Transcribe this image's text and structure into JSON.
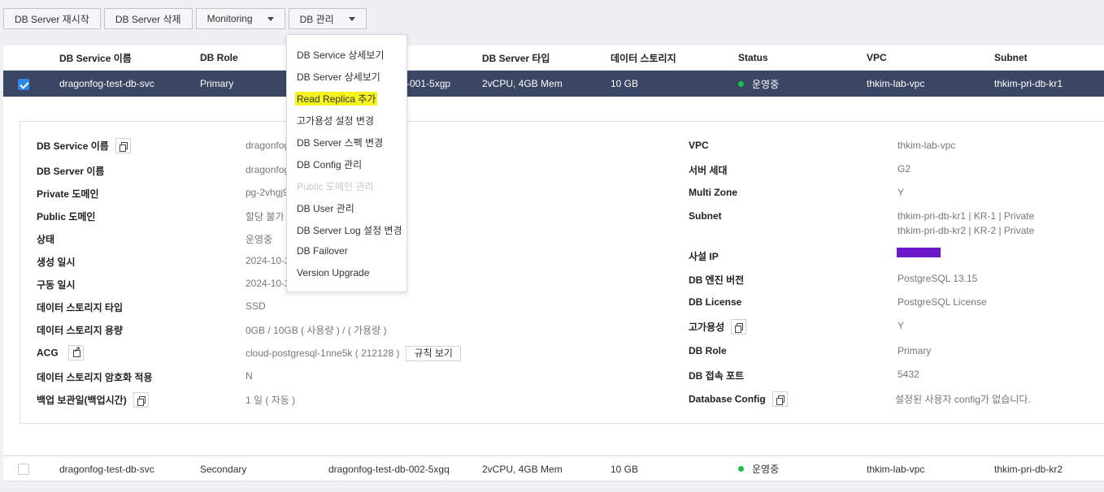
{
  "toolbar": {
    "restart": "DB Server 재시작",
    "delete": "DB Server 삭제",
    "monitoring": "Monitoring",
    "manage": "DB 관리"
  },
  "menu": {
    "items": [
      {
        "label": "DB Service 상세보기",
        "enabled": true
      },
      {
        "label": "DB Server 상세보기",
        "enabled": true
      },
      {
        "label": "Read Replica 추가",
        "enabled": true,
        "highlighted": true
      },
      {
        "label": "고가용성 설정 변경",
        "enabled": true
      },
      {
        "label": "DB Server 스펙 변경",
        "enabled": true
      },
      {
        "label": "DB Config 관리",
        "enabled": true
      },
      {
        "label": "Public 도메인 관리",
        "enabled": false
      },
      {
        "label": "DB User 관리",
        "enabled": true
      },
      {
        "label": "DB Server Log 설정 변경",
        "enabled": true
      },
      {
        "label": "DB Failover",
        "enabled": true
      },
      {
        "label": "Version Upgrade",
        "enabled": true
      }
    ]
  },
  "table": {
    "headers": [
      "DB Service 이름",
      "DB Role",
      "DB Server 이름",
      "DB Server 타입",
      "데이터 스토리지",
      "Status",
      "VPC",
      "Subnet"
    ],
    "rows": [
      {
        "service": "dragonfog-test-db-svc",
        "role": "Primary",
        "server": "dragonfog-test-db-001-5xgp",
        "type": "2vCPU, 4GB Mem",
        "storage": "10 GB",
        "status": "운영중",
        "vpc": "thkim-lab-vpc",
        "subnet": "thkim-pri-db-kr1",
        "checked": true
      },
      {
        "service": "dragonfog-test-db-svc",
        "role": "Secondary",
        "server": "dragonfog-test-db-002-5xgq",
        "type": "2vCPU, 4GB Mem",
        "storage": "10 GB",
        "status": "운영중",
        "vpc": "thkim-lab-vpc",
        "subnet": "thkim-pri-db-kr2",
        "checked": false
      }
    ],
    "row1_server_visible": "-001-5xgp"
  },
  "detail": {
    "left": {
      "service_name_label": "DB Service 이름",
      "service_name_value": "dragonfog",
      "server_name_label": "DB Server 이름",
      "server_name_value": "dragonfog",
      "private_domain_label": "Private 도메인",
      "private_domain_value": "pg-2vhgj9",
      "public_domain_label": "Public 도메인",
      "public_domain_value": "할당 불가",
      "status_label": "상태",
      "status_value": "운영중",
      "created_label": "생성 일시",
      "created_value": "2024-10-2",
      "started_label": "구동 일시",
      "started_value": "2024-10-2",
      "storage_type_label": "데이터 스토리지 타입",
      "storage_type_value": "SSD",
      "storage_size_label": "데이터 스토리지 용량",
      "storage_size_value": "0GB / 10GB ( 사용량 ) / ( 가용량 )",
      "acg_label": "ACG",
      "acg_value": "cloud-postgresql-1nne5k ( 212128 )",
      "acg_rule_button": "규칙 보기",
      "encryption_label": "데이터 스토리지 암호화 적용",
      "encryption_value": "N",
      "backup_label": "백업 보관일(백업시간)",
      "backup_value": "1 일 ( 자동 )"
    },
    "right": {
      "vpc_label": "VPC",
      "vpc_value": "thkim-lab-vpc",
      "generation_label": "서버 세대",
      "generation_value": "G2",
      "multizone_label": "Multi Zone",
      "multizone_value": "Y",
      "subnet_label": "Subnet",
      "subnet_value_1": "thkim-pri-db-kr1 | KR-1 | Private",
      "subnet_value_2": "thkim-pri-db-kr2 | KR-2 | Private",
      "private_ip_label": "사설 IP",
      "engine_label": "DB 엔진 버전",
      "engine_value": "PostgreSQL 13.15",
      "license_label": "DB License",
      "license_value": "PostgreSQL License",
      "ha_label": "고가용성",
      "ha_value": "Y",
      "role_label": "DB Role",
      "role_value": "Primary",
      "port_label": "DB 접속 포트",
      "port_value": "5432",
      "config_label": "Database Config",
      "config_value": "설정된 사용자 config가 없습니다."
    }
  },
  "colors": {
    "selected_row": "#3a4664",
    "status_running": "#1fbf4f",
    "highlight": "#f4f31d",
    "redaction": "#6e16c9"
  }
}
